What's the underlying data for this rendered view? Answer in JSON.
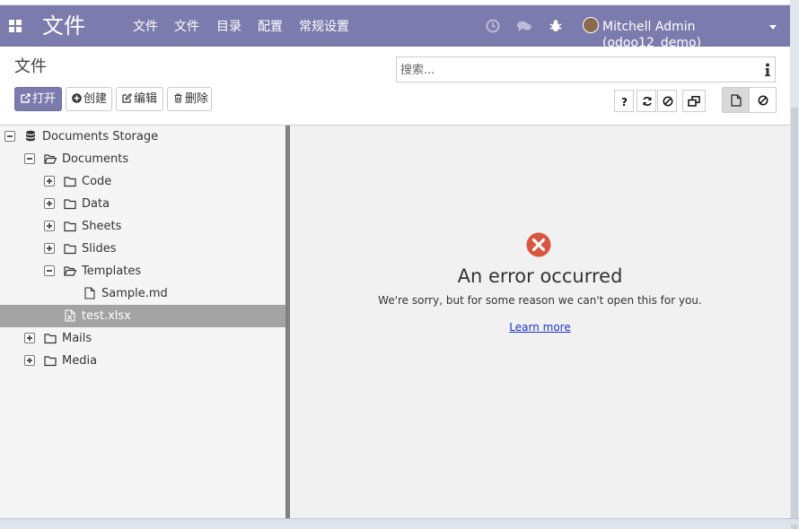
{
  "navbar": {
    "brand": "文件",
    "menus": [
      "文件",
      "文件",
      "目录",
      "配置",
      "常规设置"
    ],
    "icons": [
      "clock-icon",
      "chat-icon",
      "bug-icon"
    ],
    "user": "Mitchell Admin (odoo12_demo)"
  },
  "control_panel": {
    "breadcrumb": "文件",
    "search_placeholder": "搜索...",
    "buttons": {
      "open": "打开",
      "create": "创建",
      "edit": "编辑",
      "delete": "删除"
    }
  },
  "tree": {
    "nodes": [
      {
        "label": "Documents Storage",
        "icon": "database-icon",
        "toggle": "minus"
      },
      {
        "label": "Documents",
        "icon": "folder-open-icon",
        "toggle": "minus"
      },
      {
        "label": "Code",
        "icon": "folder-icon",
        "toggle": "plus"
      },
      {
        "label": "Data",
        "icon": "folder-icon",
        "toggle": "plus"
      },
      {
        "label": "Sheets",
        "icon": "folder-icon",
        "toggle": "plus"
      },
      {
        "label": "Slides",
        "icon": "folder-icon",
        "toggle": "plus"
      },
      {
        "label": "Templates",
        "icon": "folder-open-icon",
        "toggle": "minus"
      },
      {
        "label": "Sample.md",
        "icon": "file-icon",
        "toggle": "none"
      },
      {
        "label": "test.xlsx",
        "icon": "excel-file-icon",
        "toggle": "none",
        "selected": true
      },
      {
        "label": "Mails",
        "icon": "folder-icon",
        "toggle": "plus"
      },
      {
        "label": "Media",
        "icon": "folder-icon",
        "toggle": "plus"
      }
    ]
  },
  "viewer": {
    "error_title": "An error occurred",
    "error_message": "We're sorry, but for some reason we can't open this for you.",
    "learn_more": "Learn more"
  },
  "colors": {
    "navbar": "#7c7bad",
    "selected_row": "#a3a3a3",
    "error_icon": "#d9553f",
    "link": "#1a33cc"
  }
}
